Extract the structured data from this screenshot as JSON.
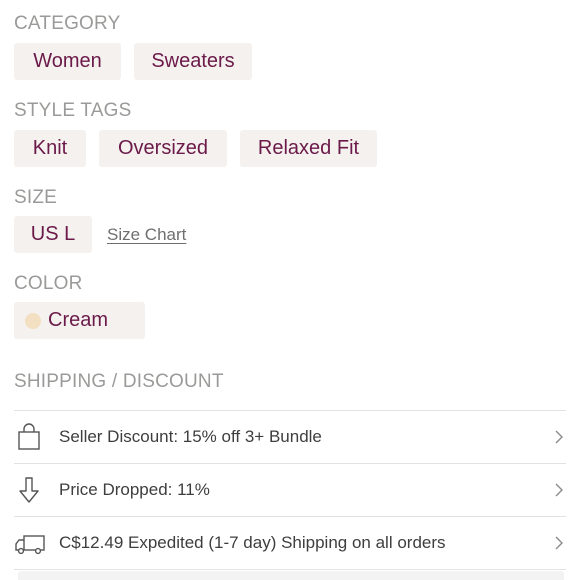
{
  "category": {
    "label": "CATEGORY",
    "items": [
      "Women",
      "Sweaters"
    ]
  },
  "style_tags": {
    "label": "STYLE TAGS",
    "items": [
      "Knit",
      "Oversized",
      "Relaxed Fit"
    ]
  },
  "size": {
    "label": "SIZE",
    "value": "US L",
    "size_chart_link": "Size Chart"
  },
  "color": {
    "label": "COLOR",
    "value": "Cream",
    "swatch_hex": "#f3dfc1"
  },
  "shipping": {
    "label": "SHIPPING / DISCOUNT",
    "rows": [
      {
        "icon": "shopping-bag-icon",
        "text": "Seller Discount: 15% off 3+ Bundle"
      },
      {
        "icon": "arrow-down-icon",
        "text": "Price Dropped: 11%"
      },
      {
        "icon": "truck-icon",
        "text": "C$12.49 Expedited (1-7 day) Shipping on all orders"
      }
    ]
  },
  "colors": {
    "chip_bg": "#f4f1ee",
    "chip_text": "#6b1a49",
    "label_gray": "#9a9a98",
    "divider": "#e4e2e0"
  }
}
